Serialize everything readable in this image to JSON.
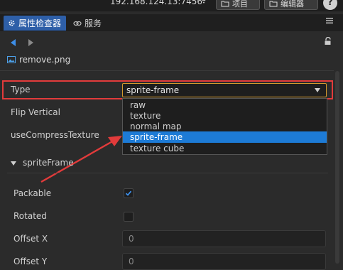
{
  "topbar": {
    "address": "192.168.124.13:7456",
    "project_label": "项目",
    "editor_label": "编辑器",
    "help_label": "?"
  },
  "tabs": [
    {
      "label": "属性检查器",
      "active": true
    },
    {
      "label": "服务",
      "active": false
    }
  ],
  "asset": {
    "filename": "remove.png"
  },
  "properties": {
    "type_label": "Type",
    "type_value": "sprite-frame",
    "flip_vertical_label": "Flip Vertical",
    "use_compress_label": "useCompressTexture"
  },
  "type_options": [
    "raw",
    "texture",
    "normal map",
    "sprite-frame",
    "texture cube"
  ],
  "selected_option_index": 3,
  "sprite_frame": {
    "section_label": "spriteFrame",
    "packable_label": "Packable",
    "packable_checked": true,
    "rotated_label": "Rotated",
    "rotated_checked": false,
    "offset_x_label": "Offset X",
    "offset_x_value": "0",
    "offset_y_label": "Offset Y",
    "offset_y_value": "0"
  },
  "colors": {
    "accent": "#2e5fa8",
    "selection": "#1d7bd6",
    "highlight_box": "#e23b3b",
    "annotation_arrow": "#e23b3b"
  }
}
